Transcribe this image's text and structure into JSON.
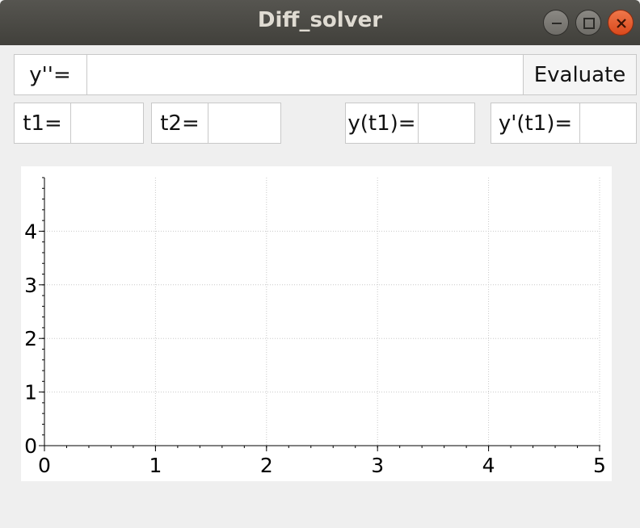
{
  "window": {
    "title": "Diff_solver",
    "buttons": [
      "minimize-icon",
      "maximize-icon",
      "close-icon"
    ]
  },
  "equation": {
    "label": "y''=",
    "value": "",
    "evaluate_label": "Evaluate"
  },
  "params": {
    "t1_label": "t1=",
    "t1_value": "",
    "t2_label": "t2=",
    "t2_value": "",
    "y_t1_label": "y(t1)=",
    "y_t1_value": "",
    "dy_t1_label": "y'(t1)=",
    "dy_t1_value": ""
  },
  "chart_data": {
    "type": "line",
    "title": "",
    "xlabel": "",
    "ylabel": "",
    "xlim": [
      0,
      5
    ],
    "ylim": [
      0,
      5
    ],
    "x_ticks": [
      "0",
      "1",
      "2",
      "3",
      "4",
      "5"
    ],
    "y_ticks": [
      "0",
      "1",
      "2",
      "3",
      "4"
    ],
    "grid": true,
    "series": []
  }
}
